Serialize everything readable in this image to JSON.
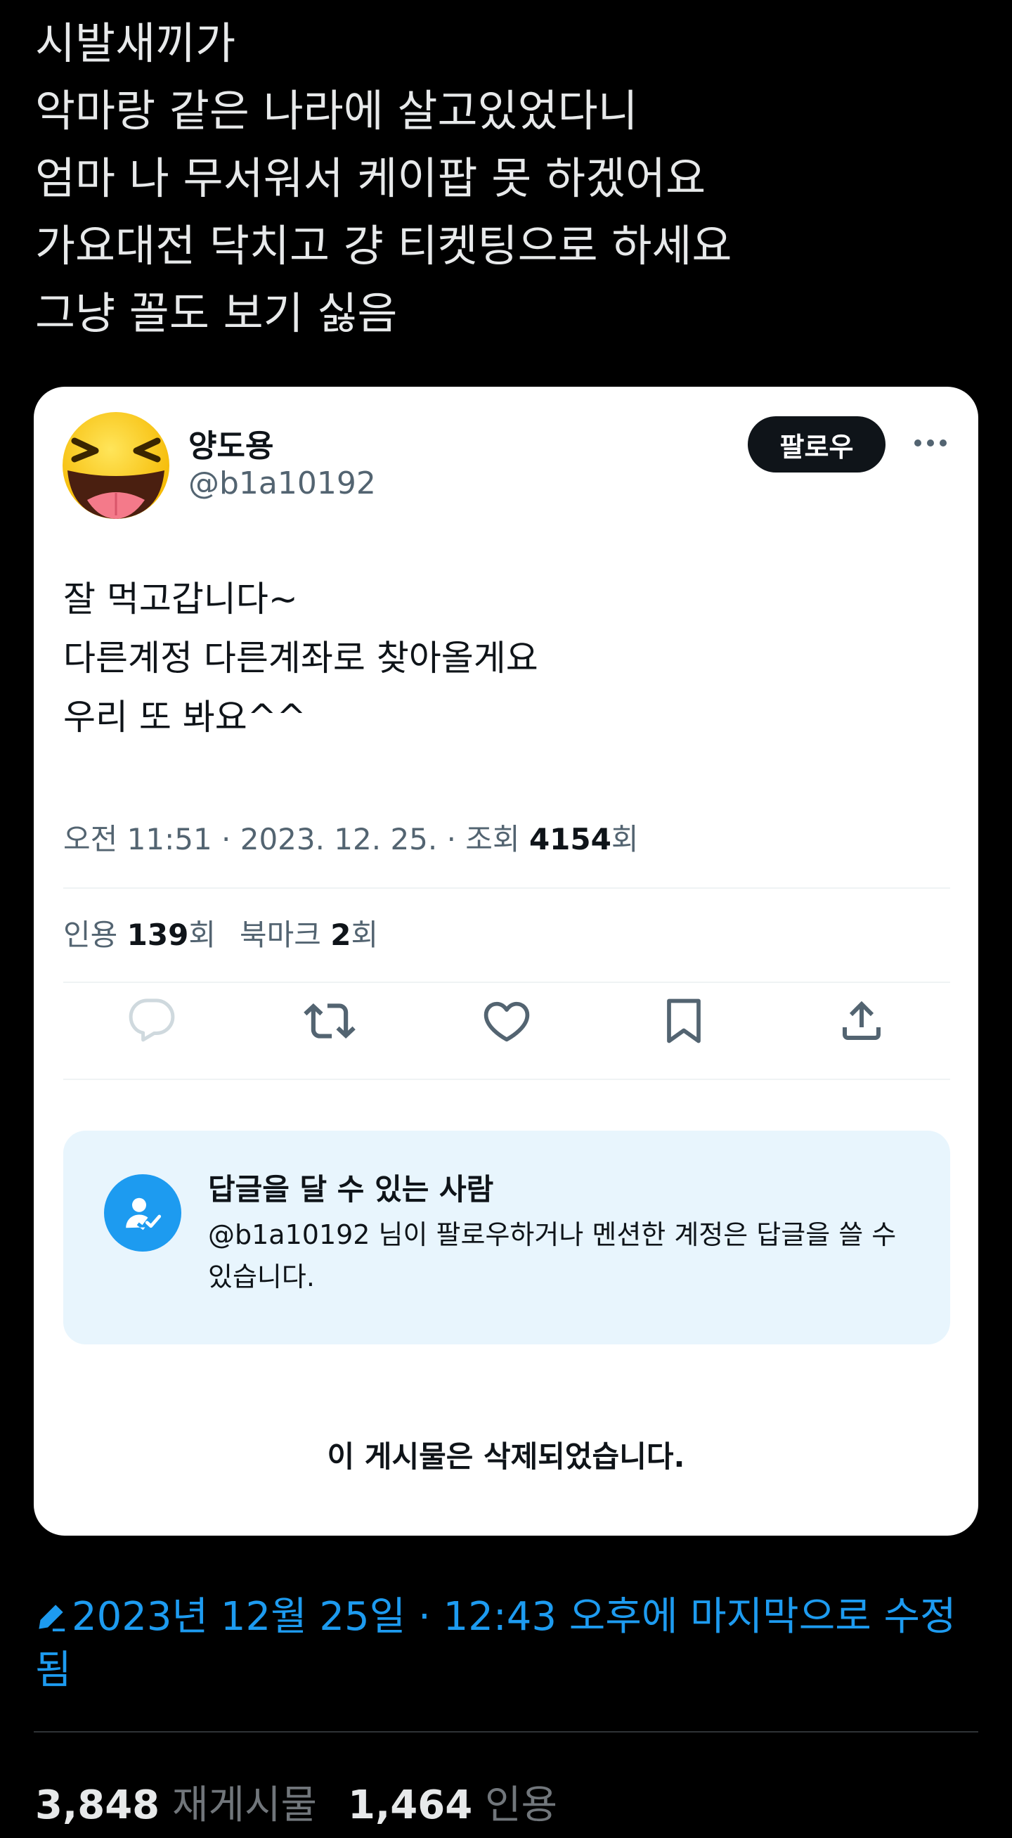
{
  "post": {
    "lines": [
      "시발새끼가",
      "악마랑 같은 나라에 살고있었다니",
      "엄마 나 무서워서 케이팝 못 하겠어요",
      "가요대전 닥치고 걍 티켓팅으로 하세요",
      "그냥 꼴도 보기 싫음"
    ],
    "edited_text": "2023년 12월 25일 · 12:43 오후에 마지막으로 수정됨",
    "reposts_count": "3,848",
    "reposts_label": "재게시물",
    "quotes_count": "1,464",
    "quotes_label": "인용",
    "accent_color": "#1d9bf0"
  },
  "quoted": {
    "author_name": "양도용",
    "author_handle": "@b1a10192",
    "follow_label": "팔로우",
    "body_lines": [
      "잘 먹고갑니다~",
      "다른계정 다른계좌로 찾아올게요",
      "우리 또 봐요^^"
    ],
    "meta_prefix": "오전 11:51 · 2023. 12. 25. · 조회 ",
    "views": "4154",
    "views_suffix": "회",
    "quote_label": "인용 ",
    "quote_count": "139",
    "quote_suffix": "회",
    "bookmark_label": "북마크 ",
    "bookmark_count": "2",
    "bookmark_suffix": "회",
    "actions": [
      "reply-icon",
      "repost-icon",
      "like-icon",
      "bookmark-icon",
      "share-icon"
    ],
    "reply_restriction_title": "답글을 달 수 있는 사람",
    "reply_restriction_desc": "@b1a10192 님이 팔로우하거나 멘션한 계정은 답글을 쓸 수 있습니다.",
    "deleted_notice": "이 게시물은 삭제되었습니다."
  }
}
